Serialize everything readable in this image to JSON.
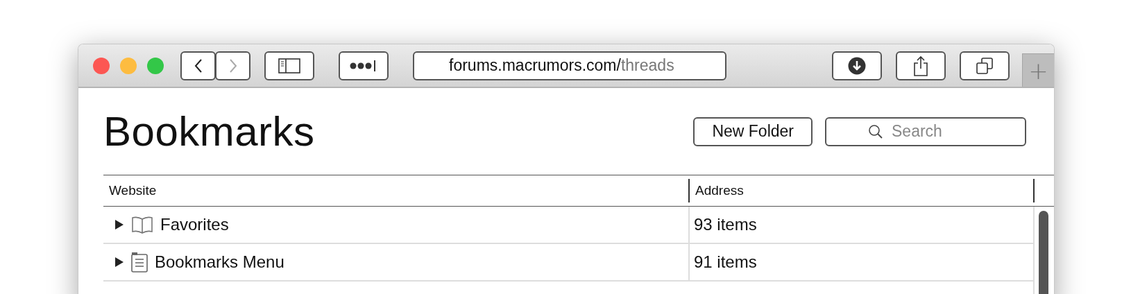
{
  "window": {
    "controls": [
      {
        "color": "#fc5753"
      },
      {
        "color": "#fdbc40"
      },
      {
        "color": "#33c748"
      }
    ]
  },
  "toolbar": {
    "nav": [
      {
        "kind": "back",
        "disabled": false
      },
      {
        "kind": "forward",
        "disabled": true
      }
    ],
    "address": {
      "domain": "forums.macrumors.com/",
      "path": "threads"
    },
    "new_tab": "+"
  },
  "page": {
    "title": "Bookmarks",
    "new_folder_button": "New Folder",
    "search": {
      "placeholder": "Search"
    }
  },
  "table": {
    "columns": [
      "Website",
      "Address"
    ],
    "rows": [
      {
        "name": "Favorites",
        "kind": "favorites",
        "address": "93 items",
        "expanded": false
      },
      {
        "name": "Bookmarks Menu",
        "kind": "menu",
        "address": "91 items",
        "expanded": false
      }
    ]
  }
}
